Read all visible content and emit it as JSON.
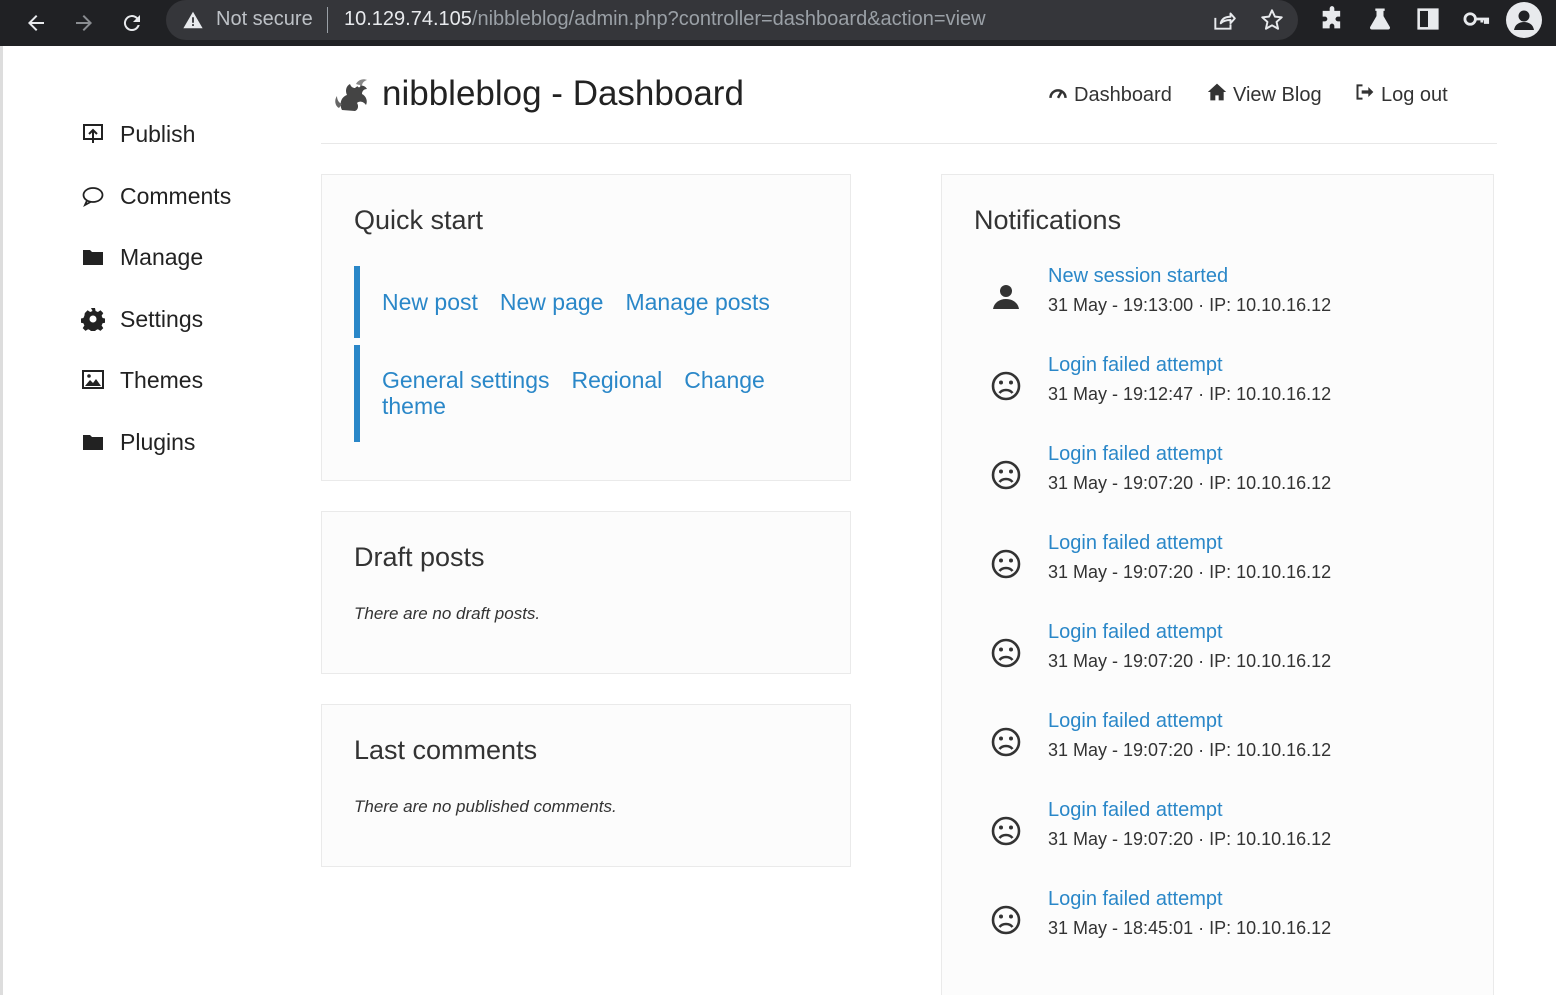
{
  "browser": {
    "security_status": "Not secure",
    "url_host": "10.129.74.105",
    "url_path": "/nibbleblog/admin.php?controller=dashboard&action=view"
  },
  "sidebar": {
    "items": [
      {
        "label": "Publish",
        "icon": "publish-icon"
      },
      {
        "label": "Comments",
        "icon": "comment-icon"
      },
      {
        "label": "Manage",
        "icon": "folder-icon"
      },
      {
        "label": "Settings",
        "icon": "gear-icon"
      },
      {
        "label": "Themes",
        "icon": "image-icon"
      },
      {
        "label": "Plugins",
        "icon": "folder-icon"
      }
    ]
  },
  "header": {
    "title": "nibbleblog - Dashboard",
    "links": [
      {
        "label": "Dashboard",
        "icon": "dashboard-icon"
      },
      {
        "label": "View Blog",
        "icon": "home-icon"
      },
      {
        "label": "Log out",
        "icon": "logout-icon"
      }
    ]
  },
  "quick_start": {
    "title": "Quick start",
    "group1": [
      "New post",
      "New page",
      "Manage posts"
    ],
    "group2": [
      "General settings",
      "Regional",
      "Change theme"
    ]
  },
  "draft_posts": {
    "title": "Draft posts",
    "message": "There are no draft posts."
  },
  "last_comments": {
    "title": "Last comments",
    "message": "There are no published comments."
  },
  "notifications": {
    "title": "Notifications",
    "items": [
      {
        "title": "New session started",
        "detail": "31 May - 19:13:00 · IP: 10.10.16.12",
        "icon": "user-icon"
      },
      {
        "title": "Login failed attempt",
        "detail": "31 May - 19:12:47 · IP: 10.10.16.12",
        "icon": "frown-icon"
      },
      {
        "title": "Login failed attempt",
        "detail": "31 May - 19:07:20 · IP: 10.10.16.12",
        "icon": "frown-icon"
      },
      {
        "title": "Login failed attempt",
        "detail": "31 May - 19:07:20 · IP: 10.10.16.12",
        "icon": "frown-icon"
      },
      {
        "title": "Login failed attempt",
        "detail": "31 May - 19:07:20 · IP: 10.10.16.12",
        "icon": "frown-icon"
      },
      {
        "title": "Login failed attempt",
        "detail": "31 May - 19:07:20 · IP: 10.10.16.12",
        "icon": "frown-icon"
      },
      {
        "title": "Login failed attempt",
        "detail": "31 May - 19:07:20 · IP: 10.10.16.12",
        "icon": "frown-icon"
      },
      {
        "title": "Login failed attempt",
        "detail": "31 May - 18:45:01 · IP: 10.10.16.12",
        "icon": "frown-icon"
      }
    ]
  },
  "colors": {
    "accent": "#2a87c8",
    "chrome_bg": "#202124"
  }
}
